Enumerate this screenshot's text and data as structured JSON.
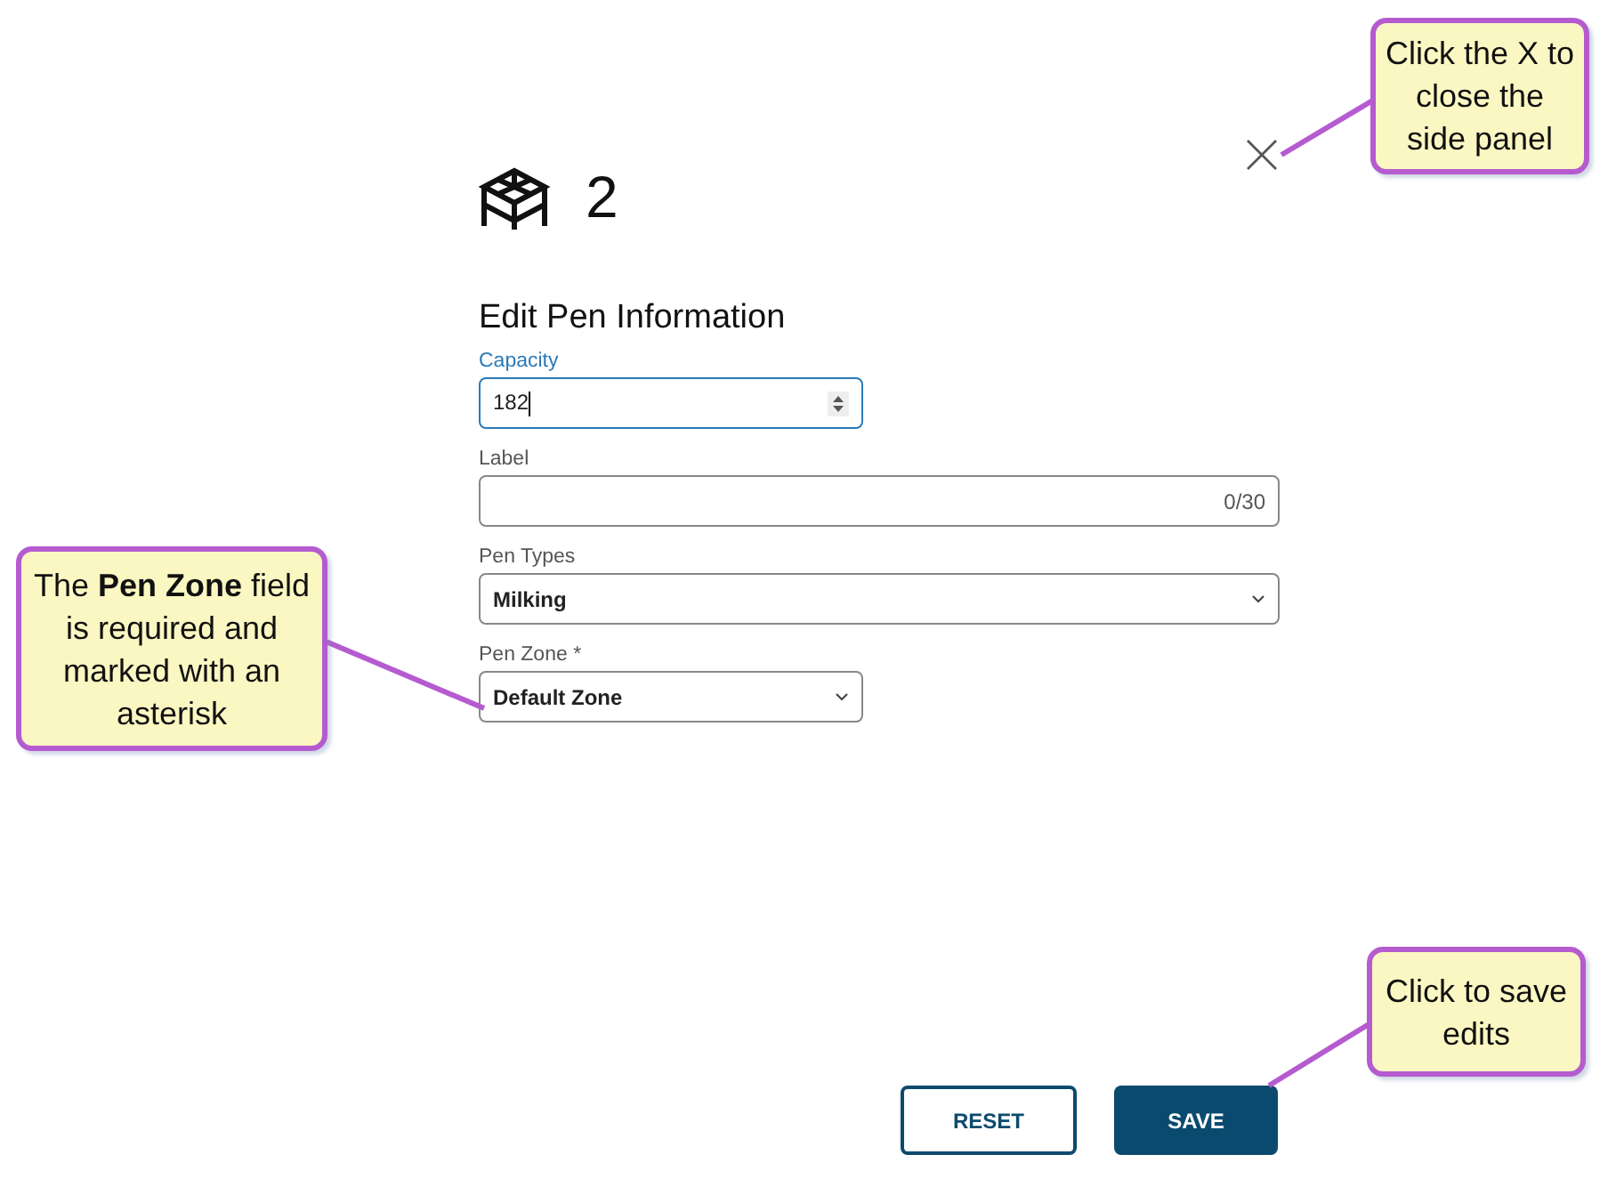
{
  "header": {
    "title": "2"
  },
  "section_title": "Edit Pen Information",
  "fields": [
    {
      "kind": "number",
      "label": "Capacity",
      "value": "182",
      "focused": true,
      "full_width": false
    },
    {
      "kind": "text",
      "label": "Label",
      "counter": "0/30",
      "focused": false,
      "full_width": true
    },
    {
      "kind": "select",
      "label": "Pen Types",
      "value": "Milking",
      "focused": false,
      "full_width": true
    },
    {
      "kind": "select",
      "label": "Pen Zone *",
      "value": "Default Zone",
      "focused": false,
      "full_width": false
    }
  ],
  "buttons": [
    {
      "kind": "outline",
      "label": "RESET"
    },
    {
      "kind": "filled",
      "label": "SAVE"
    }
  ],
  "callouts": [
    {
      "text": "Click the X to close the side panel"
    },
    {
      "text": "The **Pen Zone** field is required and marked with an asterisk"
    },
    {
      "text": "Click to save edits"
    }
  ]
}
